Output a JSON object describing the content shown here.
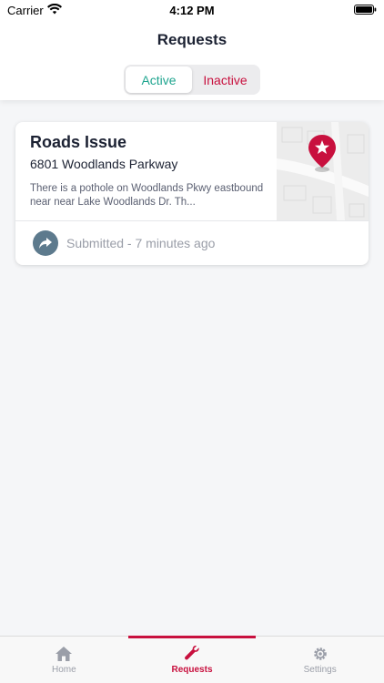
{
  "status_bar": {
    "carrier": "Carrier",
    "time": "4:12 PM"
  },
  "header": {
    "title": "Requests"
  },
  "segments": {
    "active_label": "Active",
    "inactive_label": "Inactive",
    "selected": "Active"
  },
  "request_card": {
    "title": "Roads Issue",
    "address": "6801 Woodlands Parkway",
    "description": "There is a pothole on Woodlands Pkwy eastbound near near Lake Woodlands Dr. Th...",
    "status": "Submitted - 7 minutes ago",
    "map_icon": "map-pin-star-icon",
    "status_icon": "share-arrow-icon"
  },
  "tab_bar": {
    "tabs": [
      {
        "label": "Home",
        "icon": "home-icon"
      },
      {
        "label": "Requests",
        "icon": "wrench-icon"
      },
      {
        "label": "Settings",
        "icon": "gear-icon"
      }
    ],
    "selected": "Requests"
  },
  "colors": {
    "accent_red": "#c8103e",
    "accent_teal": "#1fa58f",
    "status_circle": "#5d7a8d"
  }
}
